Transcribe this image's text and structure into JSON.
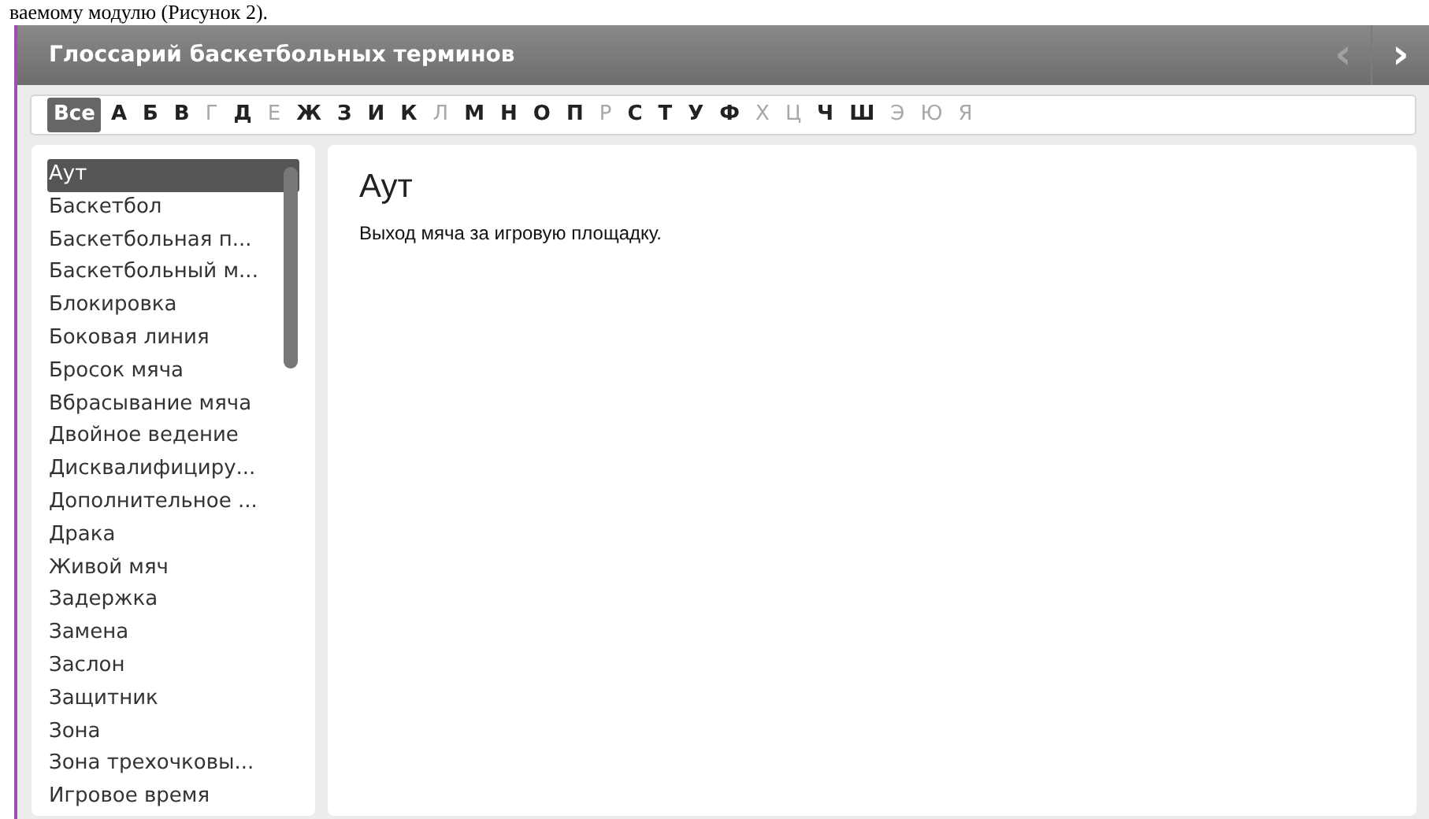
{
  "document_caption": "ваемому модулю (Рисунок 2).",
  "window": {
    "title": "Глоссарий баскетбольных терминов",
    "nav": [
      {
        "symbol": "‹",
        "disabled": true
      },
      {
        "symbol": "›",
        "disabled": false
      }
    ]
  },
  "letters": [
    {
      "label": "Все",
      "selected": true,
      "disabled": false
    },
    {
      "label": "А",
      "selected": false,
      "disabled": false
    },
    {
      "label": "Б",
      "selected": false,
      "disabled": false
    },
    {
      "label": "В",
      "selected": false,
      "disabled": false
    },
    {
      "label": "Г",
      "selected": false,
      "disabled": true
    },
    {
      "label": "Д",
      "selected": false,
      "disabled": false
    },
    {
      "label": "Е",
      "selected": false,
      "disabled": true
    },
    {
      "label": "Ж",
      "selected": false,
      "disabled": false
    },
    {
      "label": "З",
      "selected": false,
      "disabled": false
    },
    {
      "label": "И",
      "selected": false,
      "disabled": false
    },
    {
      "label": "К",
      "selected": false,
      "disabled": false
    },
    {
      "label": "Л",
      "selected": false,
      "disabled": true
    },
    {
      "label": "М",
      "selected": false,
      "disabled": false
    },
    {
      "label": "Н",
      "selected": false,
      "disabled": false
    },
    {
      "label": "О",
      "selected": false,
      "disabled": false
    },
    {
      "label": "П",
      "selected": false,
      "disabled": false
    },
    {
      "label": "Р",
      "selected": false,
      "disabled": true
    },
    {
      "label": "С",
      "selected": false,
      "disabled": false
    },
    {
      "label": "Т",
      "selected": false,
      "disabled": false
    },
    {
      "label": "У",
      "selected": false,
      "disabled": false
    },
    {
      "label": "Ф",
      "selected": false,
      "disabled": false
    },
    {
      "label": "Х",
      "selected": false,
      "disabled": true
    },
    {
      "label": "Ц",
      "selected": false,
      "disabled": true
    },
    {
      "label": "Ч",
      "selected": false,
      "disabled": false
    },
    {
      "label": "Ш",
      "selected": false,
      "disabled": false
    },
    {
      "label": "Э",
      "selected": false,
      "disabled": true
    },
    {
      "label": "Ю",
      "selected": false,
      "disabled": true
    },
    {
      "label": "Я",
      "selected": false,
      "disabled": true
    }
  ],
  "terms": [
    {
      "label": "Аут",
      "selected": true
    },
    {
      "label": "Баскетбол",
      "selected": false
    },
    {
      "label": "Баскетбольная п...",
      "selected": false
    },
    {
      "label": "Баскетбольный м...",
      "selected": false
    },
    {
      "label": "Блокировка",
      "selected": false
    },
    {
      "label": "Боковая линия",
      "selected": false
    },
    {
      "label": "Бросок мяча",
      "selected": false
    },
    {
      "label": "Вбрасывание мяча",
      "selected": false
    },
    {
      "label": "Двойное ведение",
      "selected": false
    },
    {
      "label": "Дисквалифициру...",
      "selected": false
    },
    {
      "label": "Дополнительное ...",
      "selected": false
    },
    {
      "label": "Драка",
      "selected": false
    },
    {
      "label": "Живой мяч",
      "selected": false
    },
    {
      "label": "Задержка",
      "selected": false
    },
    {
      "label": "Замена",
      "selected": false
    },
    {
      "label": "Заслон",
      "selected": false
    },
    {
      "label": "Защитник",
      "selected": false
    },
    {
      "label": "Зона",
      "selected": false
    },
    {
      "label": "Зона трехочковы...",
      "selected": false
    },
    {
      "label": "Игровое время",
      "selected": false
    }
  ],
  "definition": {
    "term": "Аут",
    "text": "Выход мяча за игровую площадку."
  }
}
